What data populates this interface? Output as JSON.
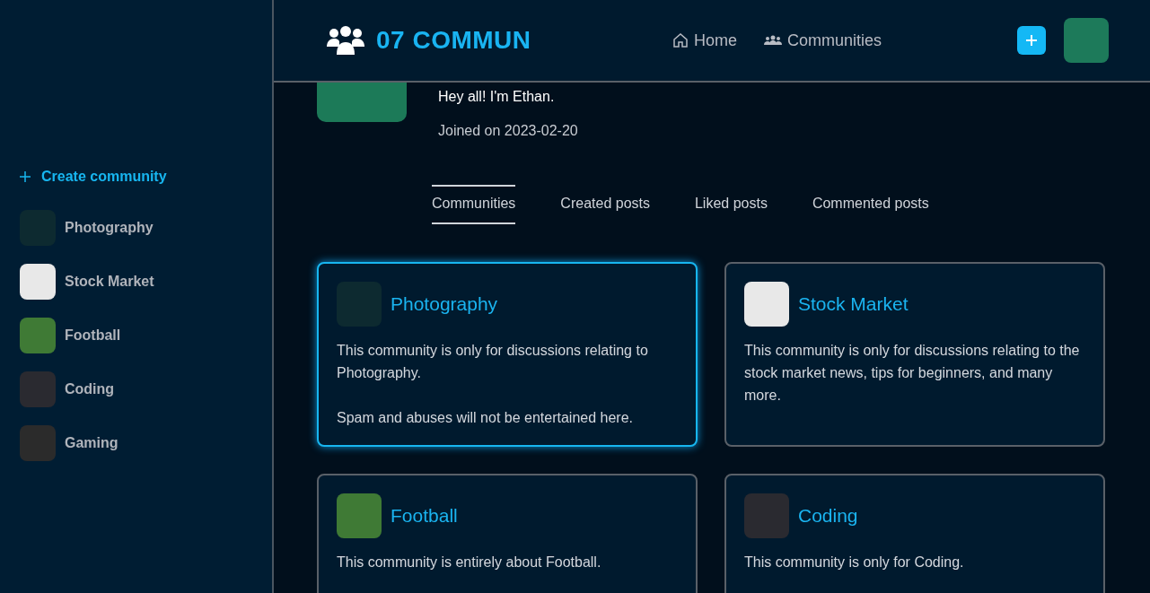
{
  "sidebar": {
    "create_label": "Create community",
    "items": [
      {
        "name": "Photography",
        "color": "#0d2a30"
      },
      {
        "name": "Stock Market",
        "color": "#e8e8e8"
      },
      {
        "name": "Football",
        "color": "#3f7a35"
      },
      {
        "name": "Coding",
        "color": "#2a2a30"
      },
      {
        "name": "Gaming",
        "color": "#2b2b2b"
      }
    ]
  },
  "header": {
    "logo": "07 COMMUN",
    "nav": [
      {
        "label": "Home",
        "kind": "home"
      },
      {
        "label": "Communities",
        "kind": "communities"
      }
    ]
  },
  "profile": {
    "bio": "Hey all! I'm Ethan.",
    "joined": "Joined on 2023-02-20"
  },
  "tabs": [
    {
      "label": "Communities",
      "selected": true
    },
    {
      "label": "Created posts",
      "selected": false
    },
    {
      "label": "Liked posts",
      "selected": false
    },
    {
      "label": "Commented posts",
      "selected": false
    }
  ],
  "cards": [
    {
      "name": "Photography",
      "color": "#0d2a30",
      "selected": true,
      "paragraphs": [
        "This community is only for discussions relating to Photography.",
        "Spam and abuses will not be entertained here."
      ]
    },
    {
      "name": "Stock Market",
      "color": "#e8e8e8",
      "selected": false,
      "paragraphs": [
        "This community is only for discussions relating to the stock market news, tips for beginners, and many more."
      ]
    },
    {
      "name": "Football",
      "color": "#3f7a35",
      "selected": false,
      "paragraphs": [
        "This community is entirely about Football."
      ]
    },
    {
      "name": "Coding",
      "color": "#2a2a30",
      "selected": false,
      "paragraphs": [
        "This community is only for Coding."
      ]
    }
  ]
}
